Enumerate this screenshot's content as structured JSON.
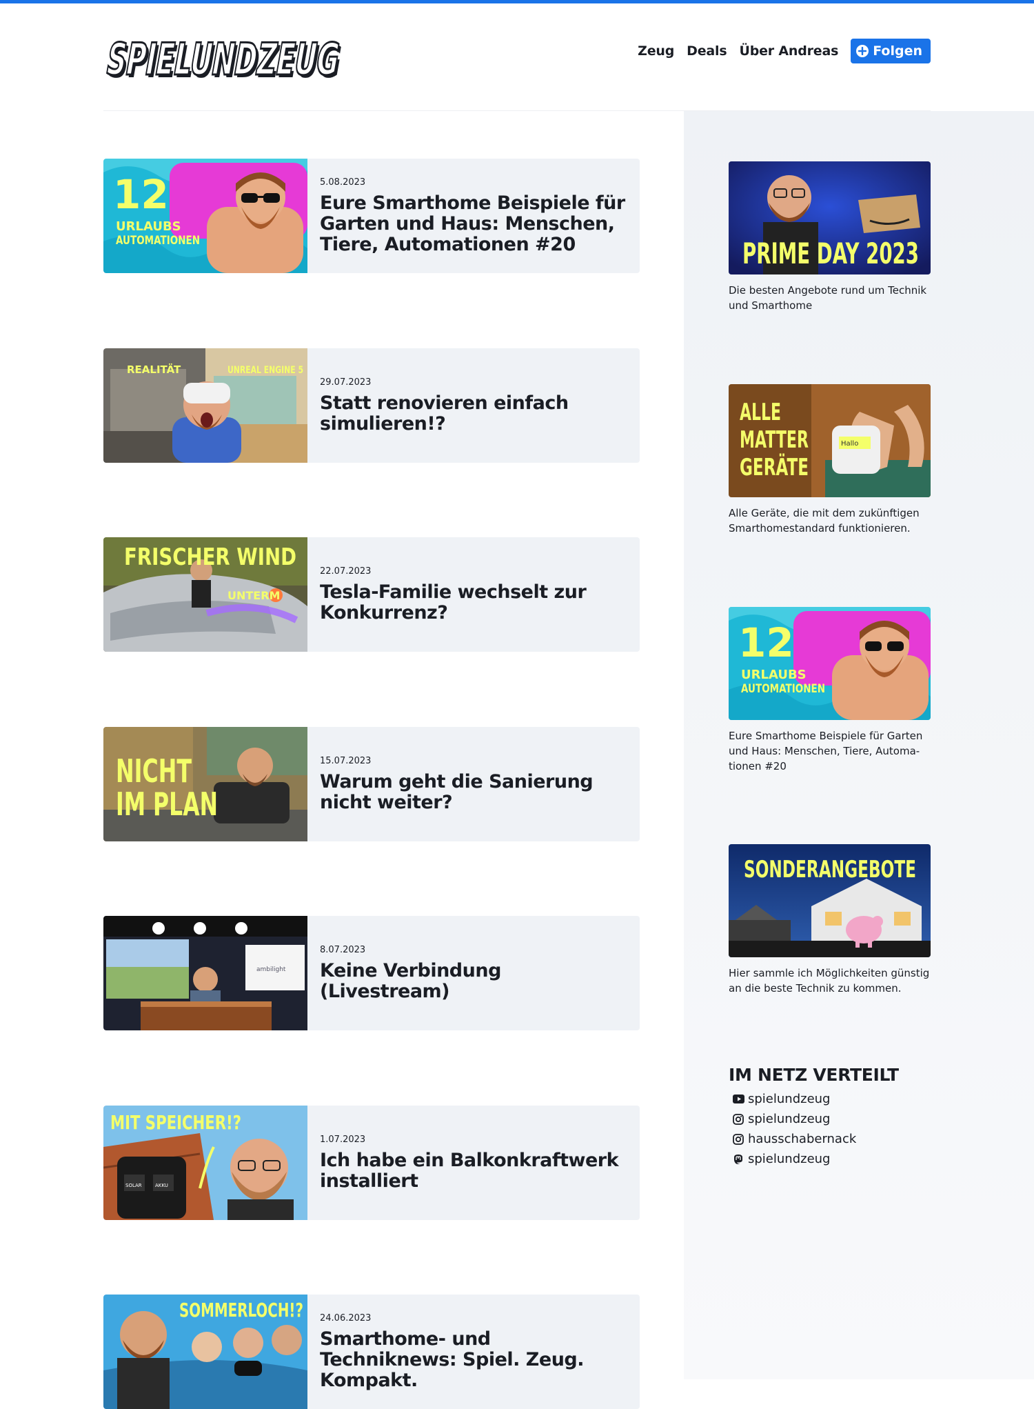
{
  "brand": {
    "logo_text": "SPIELUNDZEUG",
    "accent": "#1a73e8"
  },
  "nav": {
    "items": [
      {
        "label": "Zeug"
      },
      {
        "label": "Deals"
      },
      {
        "label": "Über Andreas"
      }
    ],
    "follow_label": "Folgen"
  },
  "articles": [
    {
      "date": "5.08.2023",
      "title": "Eure Smarthome Beispiele für Garten und Haus: Menschen, Tie­re, Automationen #20",
      "thumb": {
        "line1": "12",
        "line2": "URLAUBS",
        "line3": "AUTOMATIONEN"
      }
    },
    {
      "date": "29.07.2023",
      "title": "Statt renovieren einfach simulieren!?",
      "thumb": {
        "left": "REALITÄT",
        "right": "UNREAL ENGINE 5"
      }
    },
    {
      "date": "22.07.2023",
      "title": "Tesla-Familie wechselt zur Konkurrenz?",
      "thumb": {
        "line1": "FRISCHER WIND",
        "line2": "UNTERM"
      }
    },
    {
      "date": "15.07.2023",
      "title": "Warum geht die Sanierung nicht weiter?",
      "thumb": {
        "line1": "NICHT",
        "line2": "IM PLAN"
      }
    },
    {
      "date": "8.07.2023",
      "title": "Keine Verbindung (Livestream)",
      "thumb": {
        "screen": "ambilight"
      }
    },
    {
      "date": "1.07.2023",
      "title": "Ich habe ein Balkonkraftwerk installiert",
      "thumb": {
        "line1": "MIT SPEICHER!?",
        "solar": "SOLAR",
        "akku": "AKKU"
      }
    },
    {
      "date": "24.06.2023",
      "title": "Smarthome- und Techniknews: Spiel. Zeug. Kompakt.",
      "thumb": {
        "line1": "SOMMERLOCH!?"
      }
    }
  ],
  "sidebar": {
    "promos": [
      {
        "img_text": "PRIME DAY 2023",
        "desc": "Die besten Angebote rund um Technik und Smarthome"
      },
      {
        "img_line1": "ALLE",
        "img_line2": "MATTER",
        "img_line3": "GERÄTE",
        "plug_label": "Hallo",
        "desc": "Alle Geräte, die mit dem zukünftigen Smarthomestandard funktionieren."
      },
      {
        "img_line1": "12",
        "img_line2": "URLAUBS",
        "img_line3": "AUTOMATIONEN",
        "desc": "Eure Smarthome Beispiele für Garten und Haus: Menschen, Tiere, Automa­tionen #20"
      },
      {
        "img_text": "SONDERANGEBOTE",
        "desc": "Hier sammle ich Möglichkeiten güns­tig an die beste Technik zu kommen."
      }
    ],
    "social": {
      "heading": "IM NETZ VERTEILT",
      "items": [
        {
          "icon": "youtube-icon",
          "label": "spielundzeug"
        },
        {
          "icon": "instagram-icon",
          "label": "spielundzeug"
        },
        {
          "icon": "instagram-icon",
          "label": "hausschabernack"
        },
        {
          "icon": "mastodon-icon",
          "label": "spielundzeug"
        }
      ]
    }
  }
}
